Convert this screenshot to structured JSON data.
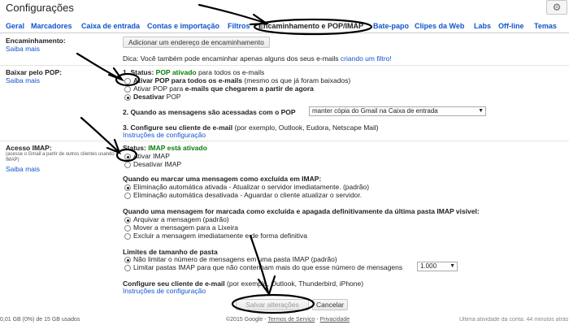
{
  "header": {
    "title": "Configurações",
    "gear_icon": "gear-icon"
  },
  "tabs": [
    {
      "label": "Geral"
    },
    {
      "label": "Marcadores"
    },
    {
      "label": "Caixa de entrada"
    },
    {
      "label": "Contas e importação"
    },
    {
      "label": "Filtros"
    },
    {
      "label": "Encaminhamento e POP/IMAP"
    },
    {
      "label": "Bate-papo"
    },
    {
      "label": "Clipes da Web"
    },
    {
      "label": "Labs"
    },
    {
      "label": "Off-line"
    },
    {
      "label": "Temas"
    }
  ],
  "forwarding": {
    "title": "Encaminhamento:",
    "help": "Saiba mais",
    "add_button": "Adicionar um endereço de encaminhamento",
    "tip": "Dica: Você também pode encaminhar apenas alguns dos seus e-mails",
    "tip_link": "criando um filtro!"
  },
  "pop": {
    "title": "Baixar pelo POP:",
    "help": "Saiba mais",
    "status_num": "1.",
    "status_label": "Status:",
    "status_value": "POP ativado",
    "status_suffix": "para todos os e-mails",
    "opt1_bold": "Ativar POP para todos os e-mails",
    "opt1_rest": "(mesmo os que já foram baixados)",
    "opt2_pre": "Ativar POP para",
    "opt2_bold": "e-mails que chegarem a partir de agora",
    "opt3": "Desativar",
    "opt3_rest": "POP",
    "q2": "2. Quando as mensagens são acessadas com o POP",
    "q2_select": "manter cópia do Gmail na Caixa de entrada",
    "q3": "3. Configure seu cliente de e-mail",
    "q3_rest": "(por exemplo, Outlook, Eudora, Netscape Mail)",
    "q3_link": "Instruções de configuração"
  },
  "imap": {
    "title": "Acesso IMAP:",
    "subtitle": "(acesse o Gmail a partir de outros clientes usando IMAP)",
    "help": "Saiba mais",
    "status_label": "Status:",
    "status_value": "IMAP está ativado",
    "enable": "Ativar IMAP",
    "disable": "Desativar IMAP",
    "delete_q": "Quando eu marcar uma mensagem como excluída em IMAP:",
    "delete_opt1": "Eliminação automática ativada - Atualizar o servidor imediatamente. (padrão)",
    "delete_opt2": "Eliminação automática desativada - Aguardar o cliente atualizar o servidor.",
    "expunge_q": "Quando uma mensagem for marcada como excluída e apagada definitivamente da última pasta IMAP visível:",
    "expunge_opt1": "Arquivar a mensagem (padrão)",
    "expunge_opt2": "Mover a mensagem para a Lixeira",
    "expunge_opt3": "Excluir a mensagem imediatamente e de forma definitiva",
    "limits_q": "Limites de tamanho de pasta",
    "limits_opt1": "Não limitar o número de mensagens em uma pasta IMAP (padrão)",
    "limits_opt2": "Limitar pastas IMAP para que não contenham mais do que esse número de mensagens",
    "limits_select": "1.000",
    "client_q": "Configure seu cliente de e-mail",
    "client_rest": "(por exemplo, Outlook, Thunderbird, iPhone)",
    "client_link": "Instruções de configuração"
  },
  "actions": {
    "save": "Salvar alterações",
    "cancel": "Cancelar"
  },
  "footer": {
    "storage": "0,01 GB (0%) de 15 GB usados",
    "copyright": "©2015 Google -",
    "terms": "Termos de Serviço",
    "sep": "-",
    "privacy": "Privacidade",
    "activity": "Última atividade da conta: 44 minutos atrás"
  }
}
